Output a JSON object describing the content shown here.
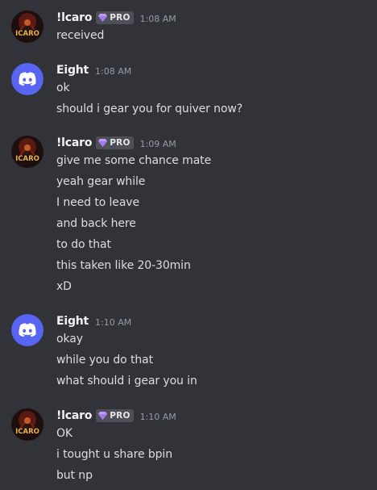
{
  "colors": {
    "background": "#313338",
    "username": "#f2f3f5",
    "message_text": "#dbdee1",
    "timestamp": "#949ba4",
    "discord_blurple": "#5865f2",
    "pro_badge_bg": "#4e5058",
    "pro_gem": "#c09bff"
  },
  "messages": [
    {
      "author": "!lcaro",
      "avatar_icon": "icaro-avatar-icon",
      "badge": "PRO",
      "timestamp": "1:08 AM",
      "lines": [
        "received"
      ]
    },
    {
      "author": "Eight",
      "avatar_icon": "discord-default-avatar-icon",
      "timestamp": "1:08 AM",
      "lines": [
        "ok",
        "should i gear you for quiver now?"
      ]
    },
    {
      "author": "!lcaro",
      "avatar_icon": "icaro-avatar-icon",
      "badge": "PRO",
      "timestamp": "1:09 AM",
      "lines": [
        "give me some chance mate",
        "yeah gear while",
        "I need to leave",
        "and back here",
        "to do that",
        "this taken like 20-30min",
        "xD"
      ]
    },
    {
      "author": "Eight",
      "avatar_icon": "discord-default-avatar-icon",
      "timestamp": "1:10 AM",
      "lines": [
        "okay",
        "while you do that",
        "what should i gear you in"
      ]
    },
    {
      "author": "!lcaro",
      "avatar_icon": "icaro-avatar-icon",
      "badge": "PRO",
      "timestamp": "1:10 AM",
      "lines": [
        "OK",
        "i tought u share bpin",
        "but np"
      ]
    }
  ]
}
